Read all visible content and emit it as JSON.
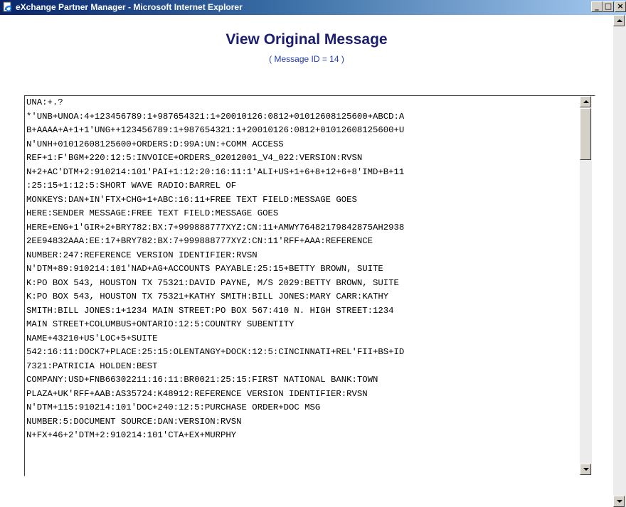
{
  "window": {
    "title": "eXchange Partner Manager - Microsoft Internet Explorer",
    "minimize_glyph": "_",
    "maximize_glyph": "□",
    "close_glyph": "×"
  },
  "page": {
    "heading": "View Original Message",
    "subheading": "( Message ID = 14 )"
  },
  "message": {
    "lines": [
      "UNA:+.?",
      "*'UNB+UNOA:4+123456789:1+987654321:1+20010126:0812+01012608125600+ABCD:A",
      "B+AAAA+A+1+1'UNG++123456789:1+987654321:1+20010126:0812+01012608125600+U",
      "N'UNH+01012608125600+ORDERS:D:99A:UN:+COMM ACCESS",
      "REF+1:F'BGM+220:12:5:INVOICE+ORDERS_02012001_V4_022:VERSION:RVSN",
      "N+2+AC'DTM+2:910214:101'PAI+1:12:20:16:11:1'ALI+US+1+6+8+12+6+8'IMD+B+11",
      ":25:15+1:12:5:SHORT WAVE RADIO:BARREL OF",
      "MONKEYS:DAN+IN'FTX+CHG+1+ABC:16:11+FREE TEXT FIELD:MESSAGE GOES",
      "HERE:SENDER MESSAGE:FREE TEXT FIELD:MESSAGE GOES",
      "HERE+ENG+1'GIR+2+BRY782:BX:7+999888777XYZ:CN:11+AMWY76482179842875AH2938",
      "2EE94832AAA:EE:17+BRY782:BX:7+999888777XYZ:CN:11'RFF+AAA:REFERENCE",
      "NUMBER:247:REFERENCE VERSION IDENTIFIER:RVSN",
      "N'DTM+89:910214:101'NAD+AG+ACCOUNTS PAYABLE:25:15+BETTY BROWN, SUITE",
      "K:PO BOX 543, HOUSTON TX 75321:DAVID PAYNE, M/S 2029:BETTY BROWN, SUITE",
      "K:PO BOX 543, HOUSTON TX 75321+KATHY SMITH:BILL JONES:MARY CARR:KATHY",
      "SMITH:BILL JONES:1+1234 MAIN STREET:PO BOX 567:410 N. HIGH STREET:1234",
      "MAIN STREET+COLUMBUS+ONTARIO:12:5:COUNTRY SUBENTITY",
      "NAME+43210+US'LOC+5+SUITE",
      "542:16:11:DOCK7+PLACE:25:15:OLENTANGY+DOCK:12:5:CINCINNATI+REL'FII+BS+ID",
      "7321:PATRICIA HOLDEN:BEST",
      "COMPANY:USD+FNB66302211:16:11:BR0021:25:15:FIRST NATIONAL BANK:TOWN",
      "PLAZA+UK'RFF+AAB:AS35724:K48912:REFERENCE VERSION IDENTIFIER:RVSN",
      "N'DTM+115:910214:101'DOC+240:12:5:PURCHASE ORDER+DOC MSG",
      "NUMBER:5:DOCUMENT SOURCE:DAN:VERSION:RVSN",
      "N+FX+46+2'DTM+2:910214:101'CTA+EX+MURPHY"
    ]
  },
  "colors": {
    "titlebar_start": "#0a246a",
    "titlebar_end": "#a6caf0",
    "heading": "#1b1d6e",
    "subheading": "#1f3bb8"
  },
  "icons": {
    "app": "ie-page-icon",
    "scroll_up": "arrow-up-icon",
    "scroll_down": "arrow-down-icon"
  }
}
